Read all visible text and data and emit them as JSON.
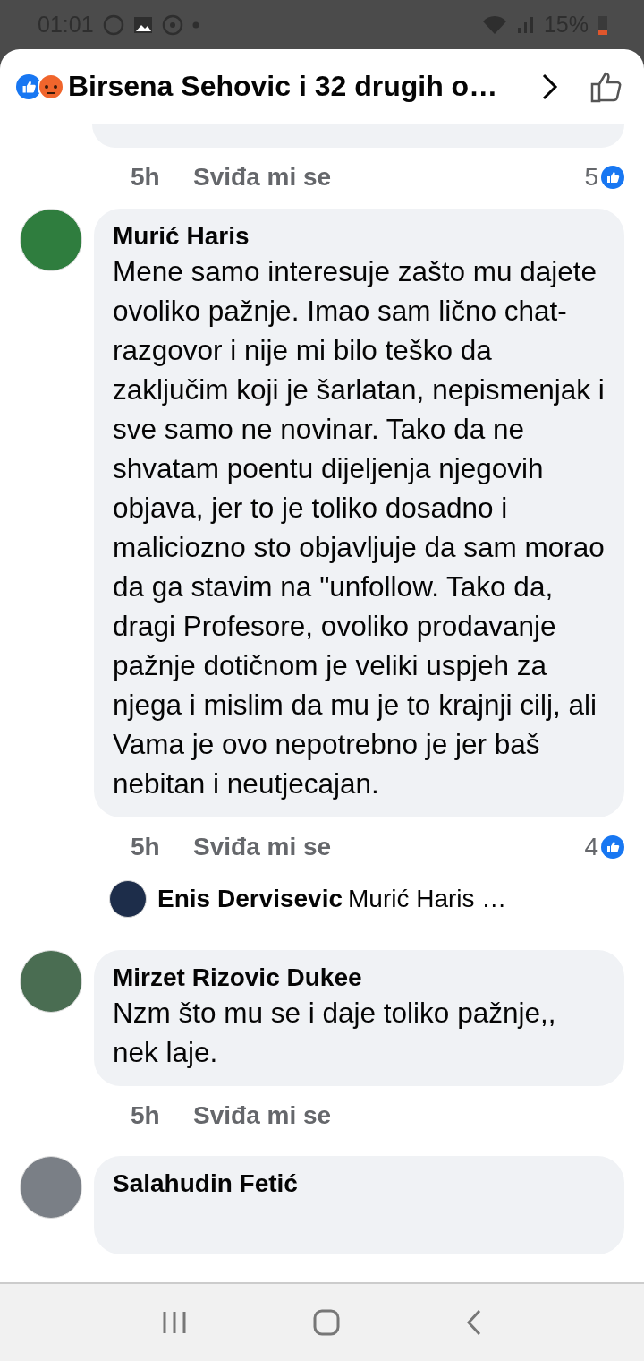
{
  "status_bar": {
    "time": "01:01",
    "battery": "15%"
  },
  "header": {
    "title": "Birsena Sehovic i 32 drugih o…"
  },
  "comments": [
    {
      "kind": "tail",
      "time": "5h",
      "like_label": "Sviđa mi se",
      "likes": "5"
    },
    {
      "kind": "full",
      "author": "Murić Haris",
      "text": "Mene samo interesuje zašto mu dajete ovoliko pažnje. Imao sam lično chat-razgovor i nije mi bilo teško da zaključim koji je šarlatan, nepismenjak i sve samo ne novinar. Tako da ne shvatam poentu dijeljenja njegovih objava, jer to je toliko dosadno i maliciozno sto objavljuje da sam morao da ga stavim na \"unfollow. Tako da, dragi Profesore, ovoliko prodavanje pažnje dotičnom je veliki uspjeh za njega i mislim da mu je to krajnji cilj, ali Vama je ovo nepotrebno je jer baš nebitan i neutjecajan.",
      "time": "5h",
      "like_label": "Sviđa mi se",
      "likes": "4",
      "reply": {
        "author": "Enis Dervisevic",
        "text": "Murić Haris …"
      }
    },
    {
      "kind": "full",
      "author": "Mirzet Rizovic Dukee",
      "text": "Nzm što mu se i daje toliko pažnje,, nek laje.",
      "time": "5h",
      "like_label": "Sviđa mi se"
    },
    {
      "kind": "head",
      "author": "Salahudin Fetić"
    }
  ]
}
